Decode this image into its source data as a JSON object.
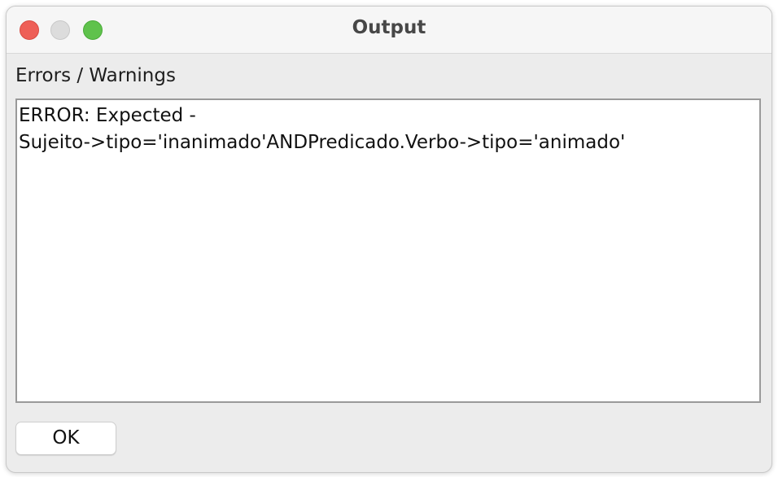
{
  "window": {
    "title": "Output",
    "controls": {
      "close_icon": "close-icon",
      "minimize_icon": "minimize-icon",
      "zoom_icon": "zoom-icon",
      "close_color": "#ee5f57",
      "minimize_color": "#dcdcdc",
      "zoom_color": "#5fc24c"
    }
  },
  "output": {
    "section_label": "Errors / Warnings",
    "lines": [
      "ERROR: Expected -",
      "Sujeito->tipo='inanimado'ANDPredicado.Verbo->tipo='animado'"
    ]
  },
  "buttons": {
    "ok_label": "OK"
  }
}
